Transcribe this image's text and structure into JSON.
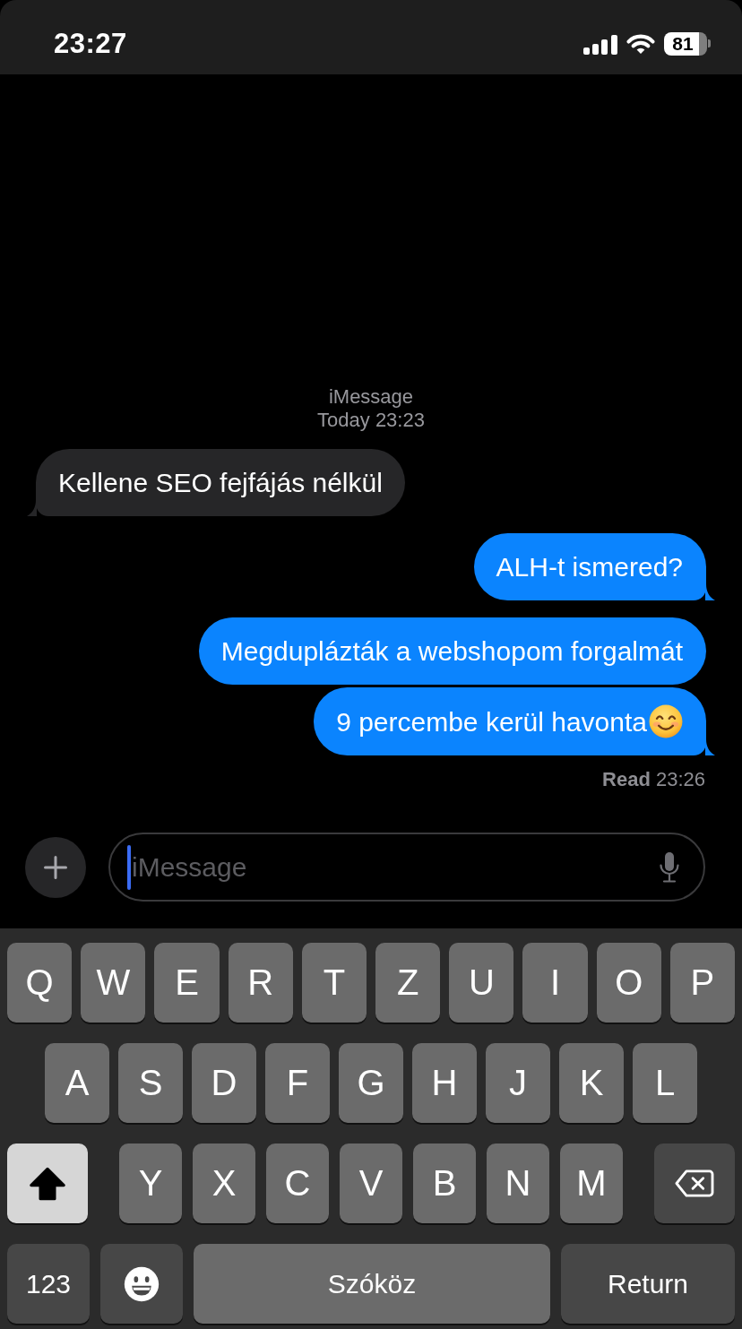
{
  "status_bar": {
    "time": "23:27",
    "battery": "81"
  },
  "conversation": {
    "service": "iMessage",
    "timestamp": "Today 23:23",
    "messages": [
      {
        "kind": "received",
        "text": "Kellene SEO fejfájás nélkül",
        "tail": true,
        "emoji": false
      },
      {
        "kind": "sent",
        "text": "ALH-t ismered?",
        "tail": true,
        "emoji": false
      },
      {
        "kind": "sent",
        "text": "Megduplázták a webshopom forgalmát",
        "tail": false,
        "emoji": false
      },
      {
        "kind": "sent",
        "text": "9 percembe kerül havonta",
        "tail": true,
        "emoji": true
      }
    ],
    "receipt": "**Read** 23:26"
  },
  "composer": {
    "placeholder": "iMessage",
    "focused": true
  },
  "keyboard": {
    "rows": [
      {
        "keys": [
          {
            "kind": "letter",
            "label": "Q"
          },
          {
            "kind": "letter",
            "label": "W"
          },
          {
            "kind": "letter",
            "label": "E"
          },
          {
            "kind": "letter",
            "label": "R"
          },
          {
            "kind": "letter",
            "label": "T"
          },
          {
            "kind": "letter",
            "label": "Z"
          },
          {
            "kind": "letter",
            "label": "U"
          },
          {
            "kind": "letter",
            "label": "I"
          },
          {
            "kind": "letter",
            "label": "O"
          },
          {
            "kind": "letter",
            "label": "P"
          }
        ]
      },
      {
        "keys": [
          {
            "kind": "letter",
            "label": "A"
          },
          {
            "kind": "letter",
            "label": "S"
          },
          {
            "kind": "letter",
            "label": "D"
          },
          {
            "kind": "letter",
            "label": "F"
          },
          {
            "kind": "letter",
            "label": "G"
          },
          {
            "kind": "letter",
            "label": "H"
          },
          {
            "kind": "letter",
            "label": "J"
          },
          {
            "kind": "letter",
            "label": "K"
          },
          {
            "kind": "letter",
            "label": "L"
          }
        ]
      },
      {
        "keys": [
          {
            "kind": "shift",
            "on": true
          },
          {
            "kind": "letter",
            "label": "Y"
          },
          {
            "kind": "letter",
            "label": "X"
          },
          {
            "kind": "letter",
            "label": "C"
          },
          {
            "kind": "letter",
            "label": "V"
          },
          {
            "kind": "letter",
            "label": "B"
          },
          {
            "kind": "letter",
            "label": "N"
          },
          {
            "kind": "letter",
            "label": "M"
          },
          {
            "kind": "backspace"
          }
        ]
      },
      {
        "keys": [
          {
            "kind": "numbers",
            "label": "123"
          },
          {
            "kind": "emoji"
          },
          {
            "kind": "space",
            "label": "Szóköz"
          },
          {
            "kind": "return",
            "label": "Return"
          }
        ]
      }
    ]
  }
}
